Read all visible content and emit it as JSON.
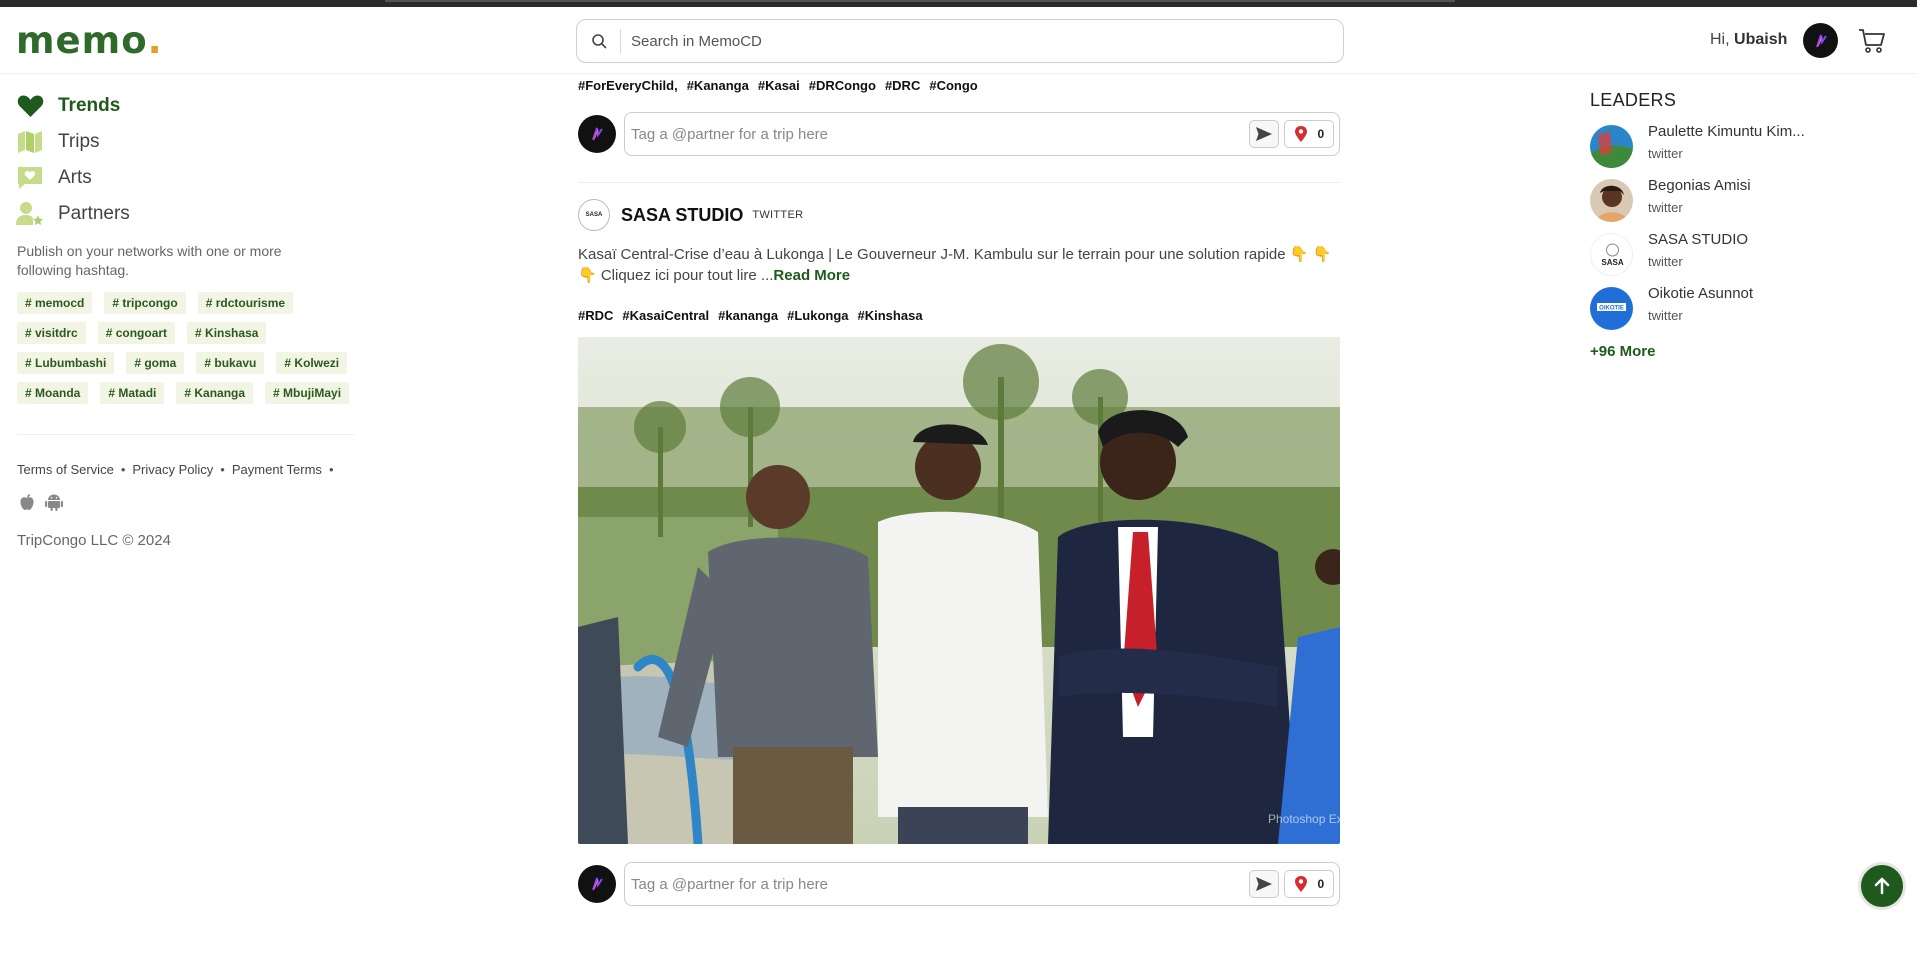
{
  "header": {
    "logo_text": "memo",
    "logo_dot": ".",
    "search_placeholder": "Search in MemoCD",
    "greeting_prefix": "Hi,",
    "user_name": "Ubaish"
  },
  "nav": [
    {
      "label": "Trends",
      "icon": "heart-icon",
      "active": true
    },
    {
      "label": "Trips",
      "icon": "map-icon",
      "active": false
    },
    {
      "label": "Arts",
      "icon": "message-heart-icon",
      "active": false
    },
    {
      "label": "Partners",
      "icon": "user-star-icon",
      "active": false
    }
  ],
  "publish_text": "Publish on your networks with one or more following hashtag.",
  "tags": [
    "# memocd",
    "# tripcongo",
    "# rdctourisme",
    "# visitdrc",
    "# congoart",
    "# Kinshasa",
    "# Lubumbashi",
    "# goma",
    "# bukavu",
    "# Kolwezi",
    "# Moanda",
    "# Matadi",
    "# Kananga",
    "# MbujiMayi"
  ],
  "footer": {
    "links": [
      "Terms of Service",
      "Privacy Policy",
      "Payment Terms"
    ],
    "copyright": "TripCongo LLC © 2024"
  },
  "feed": {
    "top_hashtags": [
      "#ForEveryChild,",
      "#Kananga",
      "#Kasai",
      "#DRCongo",
      "#DRC",
      "#Congo"
    ],
    "comment_placeholder": "Tag a @partner for a trip here",
    "pin_count_1": "0",
    "post": {
      "author": "SASA STUDIO",
      "source": "TWITTER",
      "logo_text": "SASA",
      "text": "Kasaï Central-Crise d’eau à Lukonga | Le Gouverneur J-M. Kambulu sur le terrain pour une solution rapide 👇 👇 👇  Cliquez ici pour tout lire ...",
      "read_more": "Read More",
      "hashtags": [
        "#RDC",
        "#KasaiCentral",
        "#kananga",
        "#Lukonga",
        "#Kinshasa"
      ],
      "watermark": "Photoshop Express"
    },
    "pin_count_2": "0"
  },
  "leaders": {
    "title": "LEADERS",
    "items": [
      {
        "name": "Paulette Kimuntu Kim...",
        "sub": "twitter"
      },
      {
        "name": "Begonias Amisi",
        "sub": "twitter"
      },
      {
        "name": "SASA STUDIO",
        "sub": "twitter"
      },
      {
        "name": "Oikotie Asunnot",
        "sub": "twitter",
        "badge": "OIKOTIE"
      }
    ],
    "more": "+96 More"
  },
  "colors": {
    "brand_green": "#1f5a1d",
    "logo_green": "#2e6b2a",
    "logo_dot": "#e0a126",
    "tag_bg": "#f2f5e4",
    "pin_red": "#d62e2e"
  }
}
